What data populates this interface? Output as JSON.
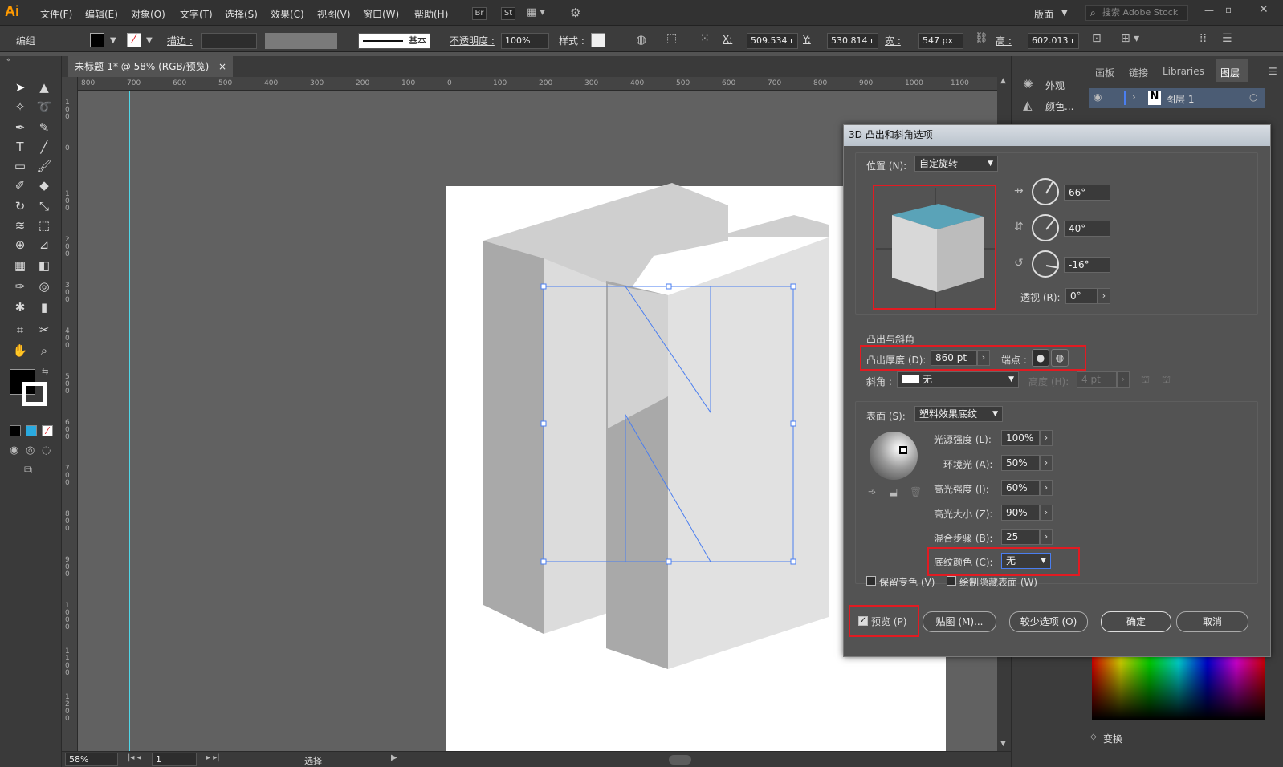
{
  "app": {
    "logo": "Ai"
  },
  "menu": [
    "文件(F)",
    "编辑(E)",
    "对象(O)",
    "文字(T)",
    "选择(S)",
    "效果(C)",
    "视图(V)",
    "窗口(W)",
    "帮助(H)"
  ],
  "menu_chips": {
    "br": "Br",
    "st": "St"
  },
  "workspace": {
    "label": "版面"
  },
  "search": {
    "placeholder": "搜索 Adobe Stock"
  },
  "control": {
    "group_label": "编组",
    "stroke_label": "描边 :",
    "stroke_style": "基本",
    "opacity_label": "不透明度 :",
    "opacity_value": "100%",
    "style_label": "样式 :",
    "x_label": "X:",
    "x_value": "509.534 ı",
    "y_label": "Y:",
    "y_value": "530.814 ı",
    "w_label": "宽 :",
    "w_value": "547 px",
    "h_label": "高 :",
    "h_value": "602.013 ı"
  },
  "document": {
    "tab_title": "未标题-1* @ 58% (RGB/预览)",
    "close": "×"
  },
  "ruler_h": [
    "800",
    "700",
    "600",
    "500",
    "400",
    "300",
    "200",
    "100",
    "0",
    "100",
    "200",
    "300",
    "400",
    "500",
    "600",
    "700",
    "800",
    "900",
    "1000",
    "1100"
  ],
  "ruler_v": [
    "100",
    "0",
    "100",
    "200",
    "300",
    "400",
    "500",
    "600",
    "700",
    "800",
    "900",
    "1000",
    "1100",
    "1200"
  ],
  "status": {
    "zoom": "58%",
    "page": "1",
    "tool": "选择"
  },
  "mid_panel": {
    "appearance": "外观",
    "color": "颜色..."
  },
  "right_panel": {
    "tabs": [
      "画板",
      "链接",
      "Libraries",
      "图层"
    ],
    "layer_name": "图层 1",
    "transform_label": "变换"
  },
  "dialog": {
    "title": "3D 凸出和斜角选项",
    "position_label": "位置 (N):",
    "position_value": "自定旋转",
    "rot_x": "66°",
    "rot_y": "40°",
    "rot_z": "-16°",
    "perspective_label": "透视 (R):",
    "perspective_value": "0°",
    "extrude_section": "凸出与斜角",
    "depth_label": "凸出厚度 (D):",
    "depth_value": "860 pt",
    "cap_label": "端点 :",
    "bevel_label": "斜角 :",
    "bevel_value": "无",
    "height_label": "高度 (H):",
    "height_value": "4 pt",
    "surface_label": "表面 (S):",
    "surface_value": "塑料效果底纹",
    "light_intensity_label": "光源强度 (L):",
    "light_intensity_value": "100%",
    "ambient_label": "环境光 (A):",
    "ambient_value": "50%",
    "highlight_intensity_label": "高光强度 (I):",
    "highlight_intensity_value": "60%",
    "highlight_size_label": "高光大小 (Z):",
    "highlight_size_value": "90%",
    "blend_steps_label": "混合步骤 (B):",
    "blend_steps_value": "25",
    "shading_color_label": "底纹颜色 (C):",
    "shading_color_value": "无",
    "preserve_spot_label": "保留专色 (V)",
    "draw_hidden_label": "绘制隐藏表面 (W)",
    "preview_label": "预览 (P)",
    "map_button": "贴图 (M)...",
    "fewer_options_button": "较少选项 (O)",
    "ok_button": "确定",
    "cancel_button": "取消",
    "cube_top_color": "#5aa3b8",
    "highlight_color": "#e21b22"
  }
}
